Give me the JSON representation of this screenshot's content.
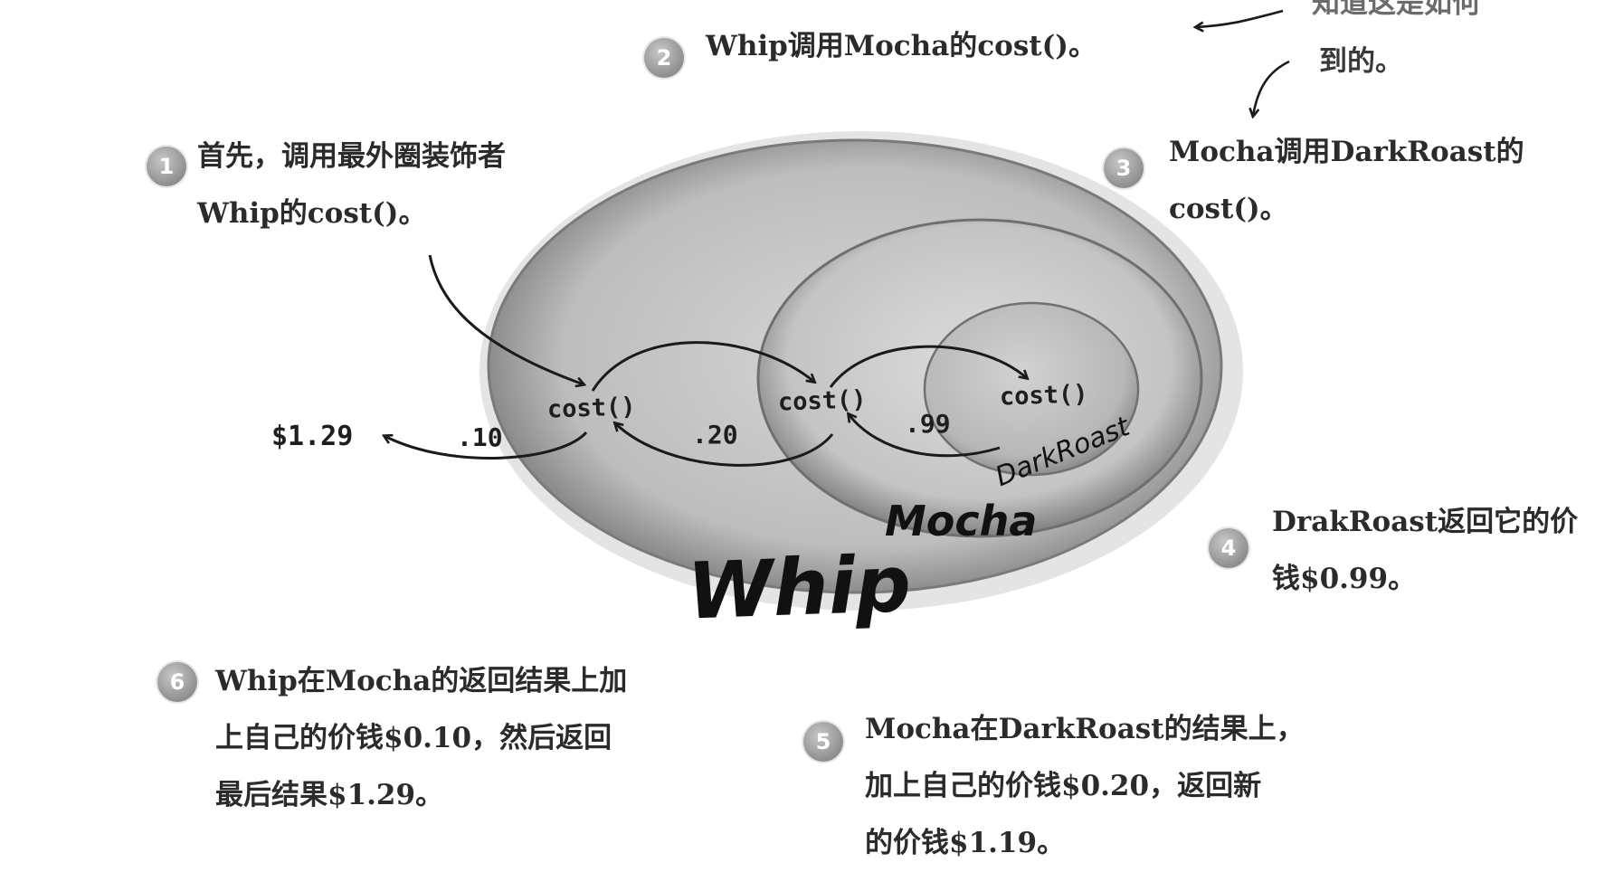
{
  "annotations": [
    {
      "number": "1",
      "lines": [
        "首先，调用最外圈装饰者",
        "Whip的cost()。"
      ]
    },
    {
      "number": "2",
      "lines": [
        "Whip调用Mocha的cost()。"
      ]
    },
    {
      "number": "3",
      "lines": [
        "Mocha调用DarkRoast的",
        "cost()。"
      ]
    },
    {
      "number": "4",
      "lines": [
        "DrakRoast返回它的价",
        "钱$0.99。"
      ]
    },
    {
      "number": "5",
      "lines": [
        "Mocha在DarkRoast的结果上，",
        "加上自己的价钱$0.20，返回新",
        "的价钱$1.19。"
      ]
    },
    {
      "number": "6",
      "lines": [
        "Whip在Mocha的返回结果上加",
        "上自己的价钱$0.10，然后返回",
        "最后结果$1.29。"
      ]
    }
  ],
  "partial_note": {
    "top_line": "知道这是如何",
    "bottom_line": "到的。"
  },
  "layers": {
    "outer": "Whip",
    "middle": "Mocha",
    "inner": "DarkRoast"
  },
  "calls": {
    "whip": "cost()",
    "mocha": "cost()",
    "darkroast": "cost()"
  },
  "returns": {
    "darkroast_value": ".99",
    "mocha_value": ".20",
    "whip_value": ".10",
    "total": "$1.29"
  },
  "colors": {
    "outer_fill": "#b9b9b9",
    "middle_fill": "#c9c9c9",
    "inner_fill": "#bdbdbd",
    "ring_edge": "#6f6f6f",
    "arrow": "#1a1a1a",
    "badge": "#9a9a9a"
  }
}
